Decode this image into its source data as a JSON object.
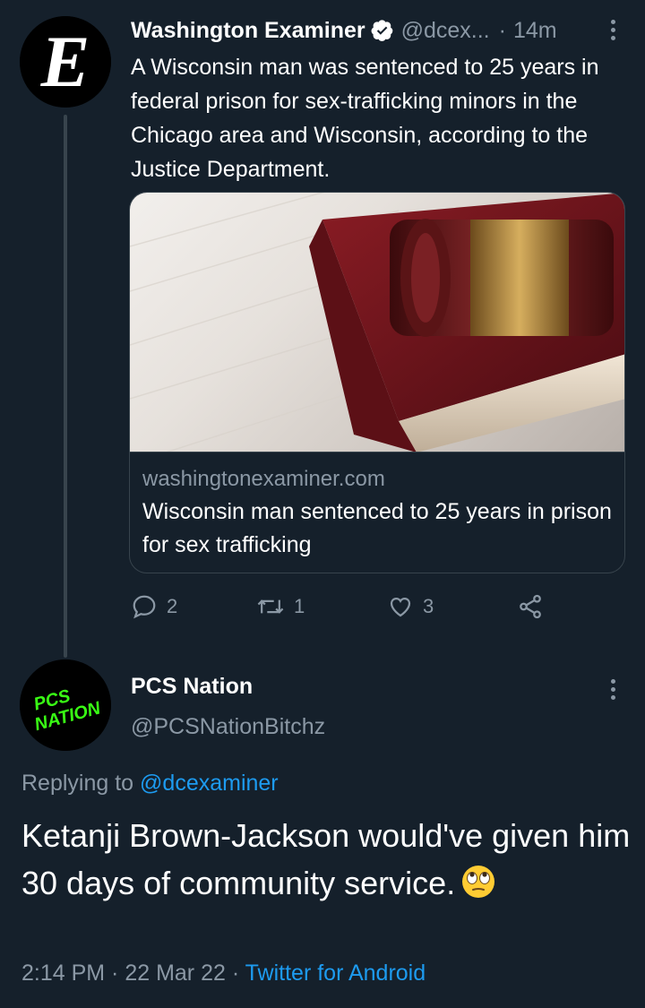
{
  "parent_tweet": {
    "author_name": "Washington Examiner",
    "handle": "@dcex...",
    "separator": "·",
    "time": "14m",
    "avatar_letter": "E",
    "text": "A Wisconsin man was sentenced to 25 years in federal prison for sex-trafficking minors in the Chicago area and Wisconsin, according to the Justice Department.",
    "link_card": {
      "domain": "washingtonexaminer.com",
      "title": "Wisconsin man sentenced to 25 years in prison for sex trafficking",
      "image_icon": "gavel-and-book-photo"
    },
    "actions": {
      "reply_count": "2",
      "retweet_count": "1",
      "like_count": "3"
    }
  },
  "reply_tweet": {
    "author_name": "PCS Nation",
    "handle": "@PCSNationBitchz",
    "avatar_text_line1": "PCS",
    "avatar_text_line2": "NATION",
    "replying_prefix": "Replying to",
    "replying_mention": "@dcexaminer",
    "text": "Ketanji Brown-Jackson would've given him 30 days of community service.",
    "emoji_icon": "face-with-rolling-eyes-icon",
    "timestamp": "2:14 PM · 22 Mar 22 ·",
    "source": "Twitter for Android"
  },
  "colors": {
    "background": "#15202b",
    "primary_text": "#ffffff",
    "secondary_text": "#8b98a5",
    "accent": "#1d9bf0",
    "border": "#38444d",
    "avatar_green": "#39ff14"
  }
}
